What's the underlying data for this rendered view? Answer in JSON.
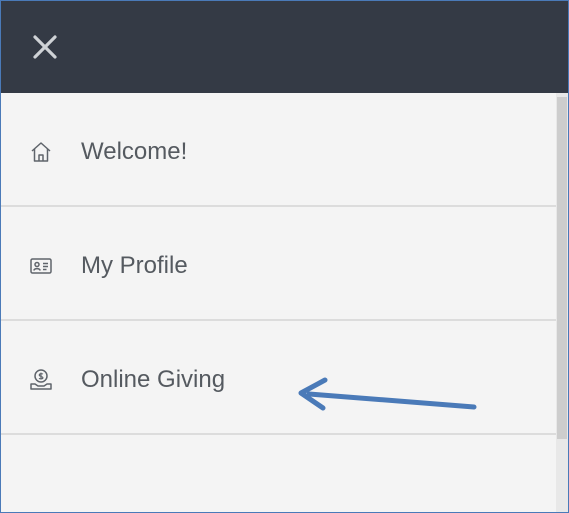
{
  "header": {
    "close_icon": "close-icon"
  },
  "menu": {
    "items": [
      {
        "label": "Welcome!",
        "icon": "home-icon"
      },
      {
        "label": "My Profile",
        "icon": "profile-card-icon"
      },
      {
        "label": "Online Giving",
        "icon": "donation-hand-icon"
      }
    ]
  },
  "annotation": {
    "arrow_color": "#4a7ab8",
    "points_to": "Online Giving"
  },
  "colors": {
    "topbar": "#343a45",
    "menu_background": "#f4f4f4",
    "label_text": "#555a60",
    "divider": "#dcdcdc"
  }
}
